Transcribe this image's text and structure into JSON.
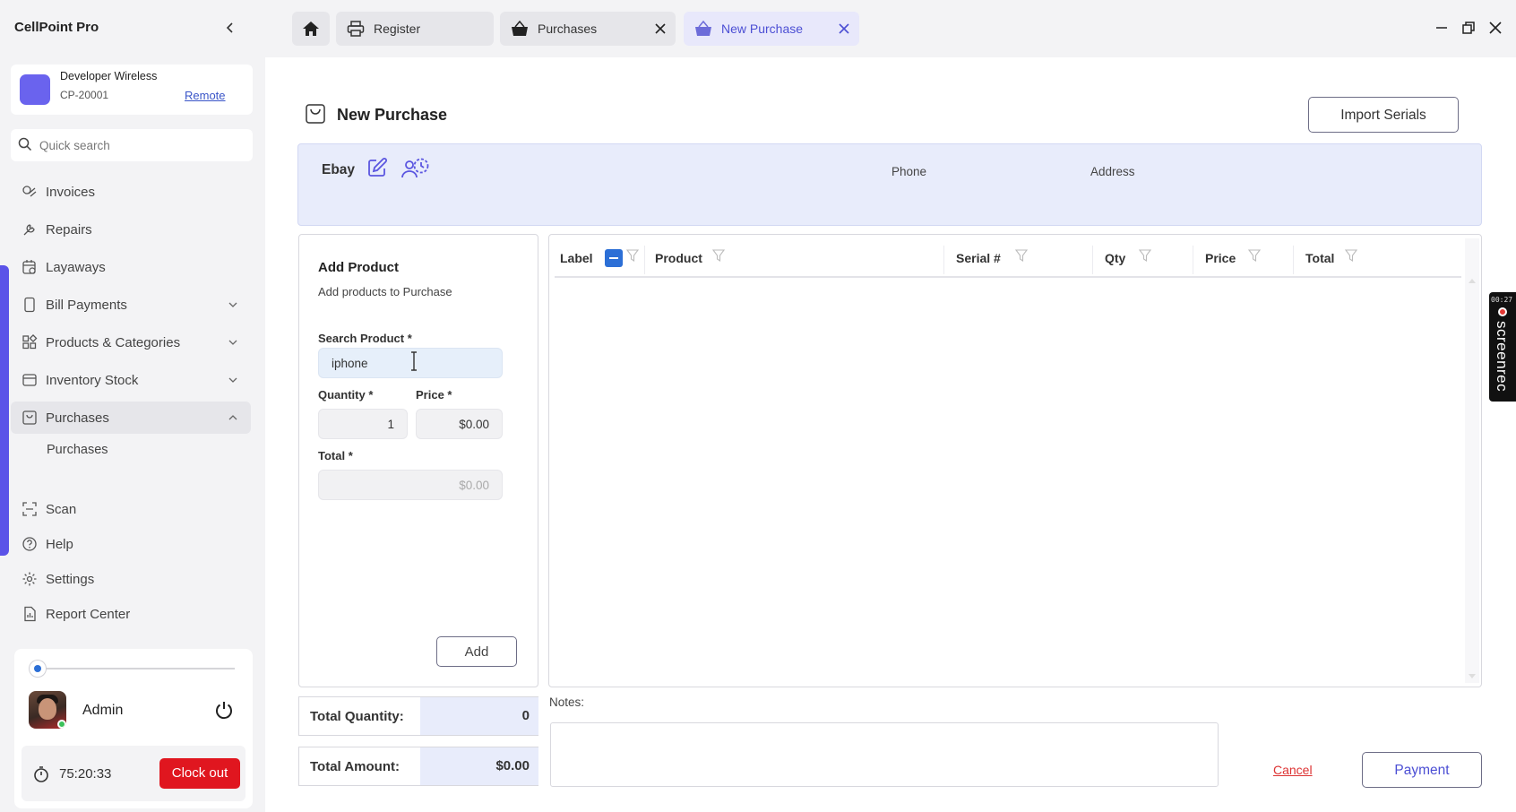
{
  "app": {
    "title": "CellPoint Pro"
  },
  "store": {
    "name": "Developer Wireless",
    "id": "CP-20001",
    "remote_label": "Remote",
    "avatar_color": "#6a63ee"
  },
  "search": {
    "placeholder": "Quick search"
  },
  "sidebar": {
    "items": [
      {
        "label": "Invoices",
        "icon": "invoice-icon"
      },
      {
        "label": "Repairs",
        "icon": "wrench-icon"
      },
      {
        "label": "Layaways",
        "icon": "calendar-clock-icon"
      },
      {
        "label": "Bill Payments",
        "icon": "mobile-icon"
      },
      {
        "label": "Products & Categories",
        "icon": "grid-icon"
      },
      {
        "label": "Inventory Stock",
        "icon": "box-icon"
      },
      {
        "label": "Purchases",
        "icon": "bag-icon"
      },
      {
        "label": "Scan",
        "icon": "scan-icon"
      },
      {
        "label": "Help",
        "icon": "help-icon"
      },
      {
        "label": "Settings",
        "icon": "gear-icon"
      },
      {
        "label": "Report Center",
        "icon": "report-icon"
      }
    ],
    "sub_items": {
      "purchases": "Purchases"
    }
  },
  "user": {
    "name": "Admin",
    "timer": "75:20:33",
    "clockout_label": "Clock out"
  },
  "tabs": [
    {
      "label": "Register",
      "icon": "printer-icon"
    },
    {
      "label": "Purchases",
      "icon": "basket-icon"
    },
    {
      "label": "New Purchase",
      "icon": "basket-icon"
    }
  ],
  "page": {
    "title": "New Purchase",
    "import_label": "Import Serials"
  },
  "vendor": {
    "name": "Ebay",
    "phone_label": "Phone",
    "address_label": "Address"
  },
  "add_product": {
    "title": "Add Product",
    "subtitle": "Add products to Purchase",
    "search_label": "Search Product *",
    "search_value": "iphone",
    "quantity_label": "Quantity *",
    "quantity_value": "1",
    "price_label": "Price *",
    "price_value": "$0.00",
    "total_label": "Total *",
    "total_value": "$0.00",
    "add_label": "Add"
  },
  "grid": {
    "columns": [
      "Label",
      "Product",
      "Serial #",
      "Qty",
      "Price",
      "Total"
    ],
    "rows": []
  },
  "summary": {
    "total_quantity_label": "Total Quantity:",
    "total_quantity_value": "0",
    "total_amount_label": "Total Amount:",
    "total_amount_value": "$0.00"
  },
  "notes": {
    "label": "Notes:"
  },
  "actions": {
    "cancel_label": "Cancel",
    "payment_label": "Payment"
  },
  "recorder": {
    "time": "00:27",
    "label": "screenrec"
  },
  "colors": {
    "accent": "#5b53e8",
    "danger": "#e0161f",
    "link": "#3a55c8"
  }
}
